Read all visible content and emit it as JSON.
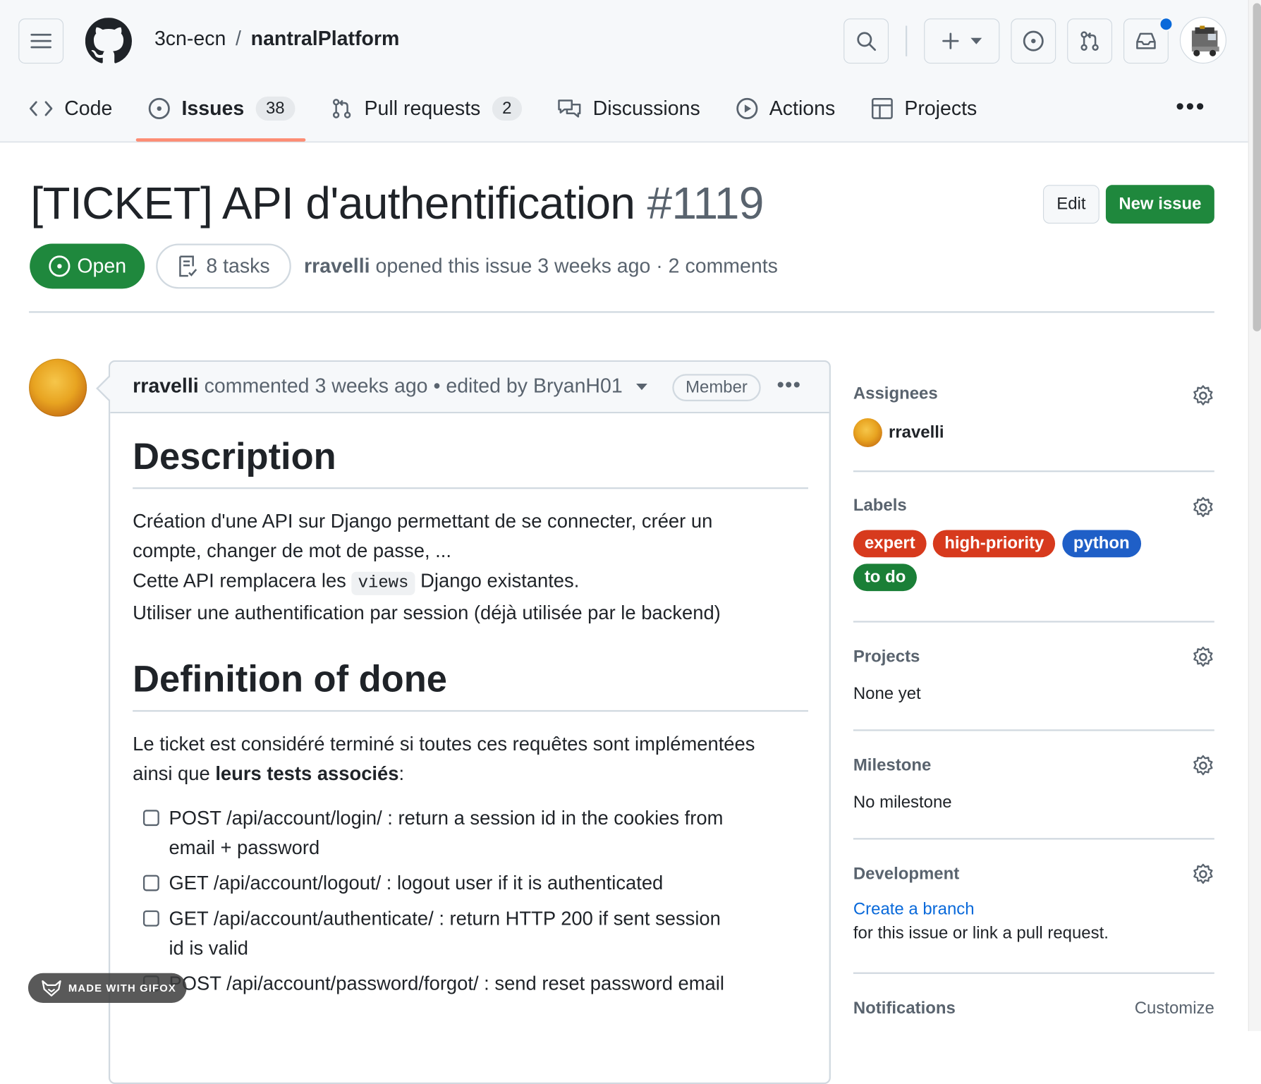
{
  "header": {
    "owner": "3cn-ecn",
    "separator": "/",
    "repo": "nantralPlatform",
    "icons": [
      "menu-icon",
      "github-logo-icon",
      "search-icon",
      "plus-icon",
      "issue-icon",
      "pull-request-icon",
      "inbox-icon",
      "avatar"
    ],
    "notification_color": "#0969da"
  },
  "tabs": [
    {
      "label": "Code",
      "icon": "code-icon"
    },
    {
      "label": "Issues",
      "icon": "issue-icon",
      "count": "38",
      "selected": true
    },
    {
      "label": "Pull requests",
      "icon": "pull-request-icon",
      "count": "2"
    },
    {
      "label": "Discussions",
      "icon": "discussion-icon"
    },
    {
      "label": "Actions",
      "icon": "play-icon"
    },
    {
      "label": "Projects",
      "icon": "table-icon"
    }
  ],
  "issue": {
    "title": "[TICKET] API d'authentification",
    "number": "#1119",
    "edit_label": "Edit",
    "new_issue_label": "New issue",
    "state": "Open",
    "tasks": "8 tasks",
    "author": "rravelli",
    "meta": "opened this issue 3 weeks ago · 2 comments"
  },
  "comment": {
    "author": "rravelli",
    "meta": "commented 3 weeks ago • edited by BryanH01",
    "role": "Member",
    "h_description": "Description",
    "desc_line1": "Création d'une API sur Django permettant de se connecter, créer un",
    "desc_line2": "compte, changer de mot de passe, ...",
    "desc_line3_pre": "Cette API remplacera les",
    "desc_line3_code": "views",
    "desc_line3_post": "Django existantes.",
    "desc_line4": "Utiliser une authentification par session (déjà utilisée par le backend)",
    "h_done": "Definition of done",
    "done_line1": "Le ticket est considéré terminé si toutes ces requêtes sont implémentées",
    "done_line2_pre": "ainsi que",
    "done_line2_bold": "leurs tests associés",
    "done_line2_post": ":",
    "tasks": [
      {
        "l1": "POST /api/account/login/ : return a session id in the cookies from",
        "l2": "email + password"
      },
      {
        "l1": "GET /api/account/logout/ : logout user if it is authenticated",
        "l2": ""
      },
      {
        "l1": "GET /api/account/authenticate/ : return HTTP 200 if sent session",
        "l2": "id is valid"
      },
      {
        "l1": "POST /api/account/password/forgot/ : send reset password email",
        "l2": ""
      }
    ]
  },
  "sidebar": {
    "assignees": {
      "title": "Assignees",
      "user": "rravelli"
    },
    "labels": {
      "title": "Labels",
      "items": [
        {
          "name": "expert",
          "color": "#d73a1d"
        },
        {
          "name": "high-priority",
          "color": "#d73a1d"
        },
        {
          "name": "python",
          "color": "#1f5fc7"
        },
        {
          "name": "to do",
          "color": "#1a7f37"
        }
      ]
    },
    "projects": {
      "title": "Projects",
      "value": "None yet"
    },
    "milestone": {
      "title": "Milestone",
      "value": "No milestone"
    },
    "development": {
      "title": "Development",
      "link": "Create a branch",
      "text": "for this issue or link a pull request."
    },
    "notifications": {
      "title": "Notifications",
      "action": "Customize"
    }
  },
  "watermark": "MADE WITH GIFOX"
}
